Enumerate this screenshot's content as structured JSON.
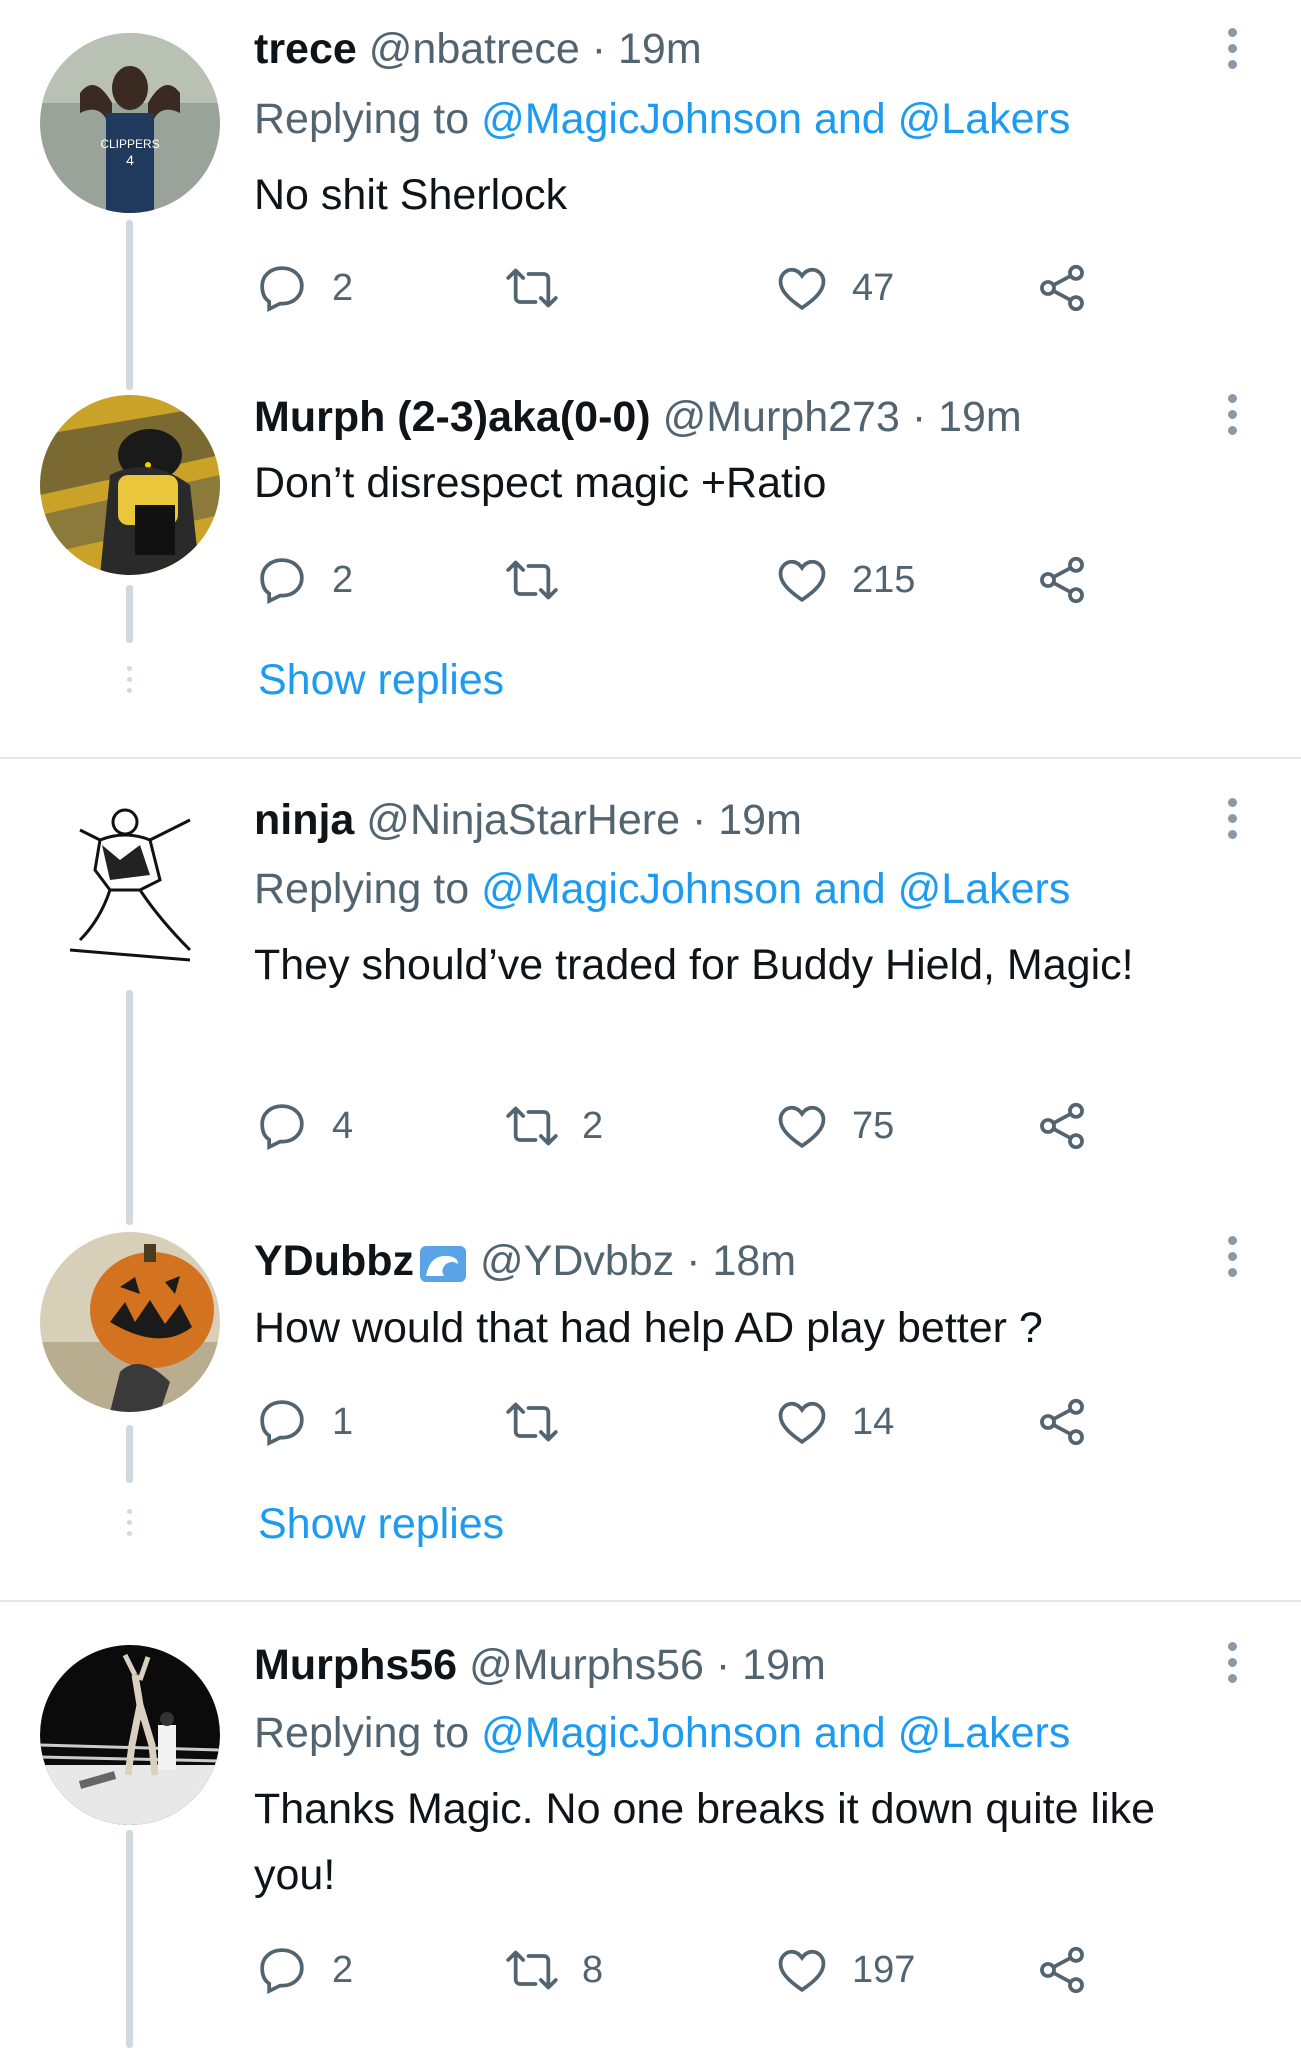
{
  "colors": {
    "link": "#1d9bf0",
    "muted": "#536471",
    "text": "#0f1419",
    "line": "#cfd9de"
  },
  "tweets": [
    {
      "name": "trece",
      "handle": "@nbatrece",
      "sep": "·",
      "time": "19m",
      "reply_prefix": "Replying to",
      "reply_targets": "@MagicJohnson and @Lakers",
      "text": "No shit Sherlock",
      "replies": "2",
      "retweets": "",
      "likes": "47"
    },
    {
      "name": "Murph (2-3)aka(0-0)",
      "handle": "@Murph273",
      "sep": "·",
      "time": "19m",
      "text": "Don’t disrespect magic +Ratio",
      "replies": "2",
      "retweets": "",
      "likes": "215",
      "show_replies": "Show replies"
    },
    {
      "name": "ninja",
      "handle": "@NinjaStarHere",
      "sep": "·",
      "time": "19m",
      "reply_prefix": "Replying to",
      "reply_targets": "@MagicJohnson and @Lakers",
      "text": "They should’ve traded for Buddy Hield, Magic!",
      "replies": "4",
      "retweets": "2",
      "likes": "75"
    },
    {
      "name": "YDubbz",
      "handle": "@YDvbbz",
      "sep": "·",
      "time": "18m",
      "text": "How would that had help AD play better ?",
      "replies": "1",
      "retweets": "",
      "likes": "14",
      "show_replies": "Show replies"
    },
    {
      "name": "Murphs56",
      "handle": "@Murphs56",
      "sep": "·",
      "time": "19m",
      "reply_prefix": "Replying to",
      "reply_targets": "@MagicJohnson and @Lakers",
      "text": "Thanks Magic. No one breaks it down quite like you!",
      "replies": "2",
      "retweets": "8",
      "likes": "197"
    }
  ]
}
